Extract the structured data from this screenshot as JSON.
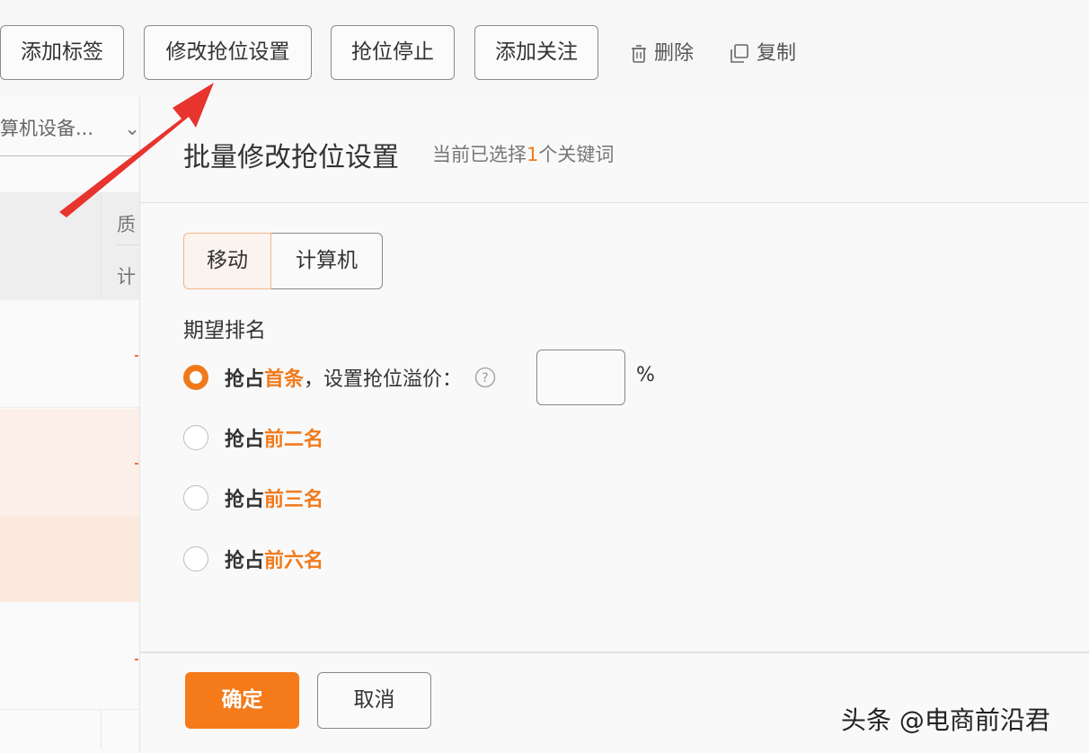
{
  "toolbar": {
    "add_tag": "添加标签",
    "modify_bid": "修改抢位设置",
    "stop_bid": "抢位停止",
    "add_follow": "添加关注",
    "delete": "删除",
    "copy": "复制"
  },
  "background": {
    "device_select": "算机设备...",
    "col_header_1": "质",
    "col_header_2": "计"
  },
  "modal": {
    "title": "批量修改抢位设置",
    "subtitle_prefix": "当前已选择",
    "subtitle_count": "1",
    "subtitle_suffix": "个关键词",
    "tabs": [
      {
        "label": "移动",
        "active": true
      },
      {
        "label": "计算机",
        "active": false
      }
    ],
    "section_label": "期望排名",
    "options": [
      {
        "prefix": "抢占",
        "highlight": "首条",
        "rest": "，设置抢位溢价：",
        "checked": true
      },
      {
        "prefix": "抢占",
        "highlight": "前二名",
        "rest": "",
        "checked": false
      },
      {
        "prefix": "抢占",
        "highlight": "前三名",
        "rest": "",
        "checked": false
      },
      {
        "prefix": "抢占",
        "highlight": "前六名",
        "rest": "",
        "checked": false
      }
    ],
    "price_input_value": "",
    "percent_unit": "%",
    "ok_label": "确定",
    "cancel_label": "取消"
  },
  "watermark": "头条 @电商前沿君",
  "colors": {
    "accent": "#f47a1a",
    "arrow": "#e8342e"
  }
}
